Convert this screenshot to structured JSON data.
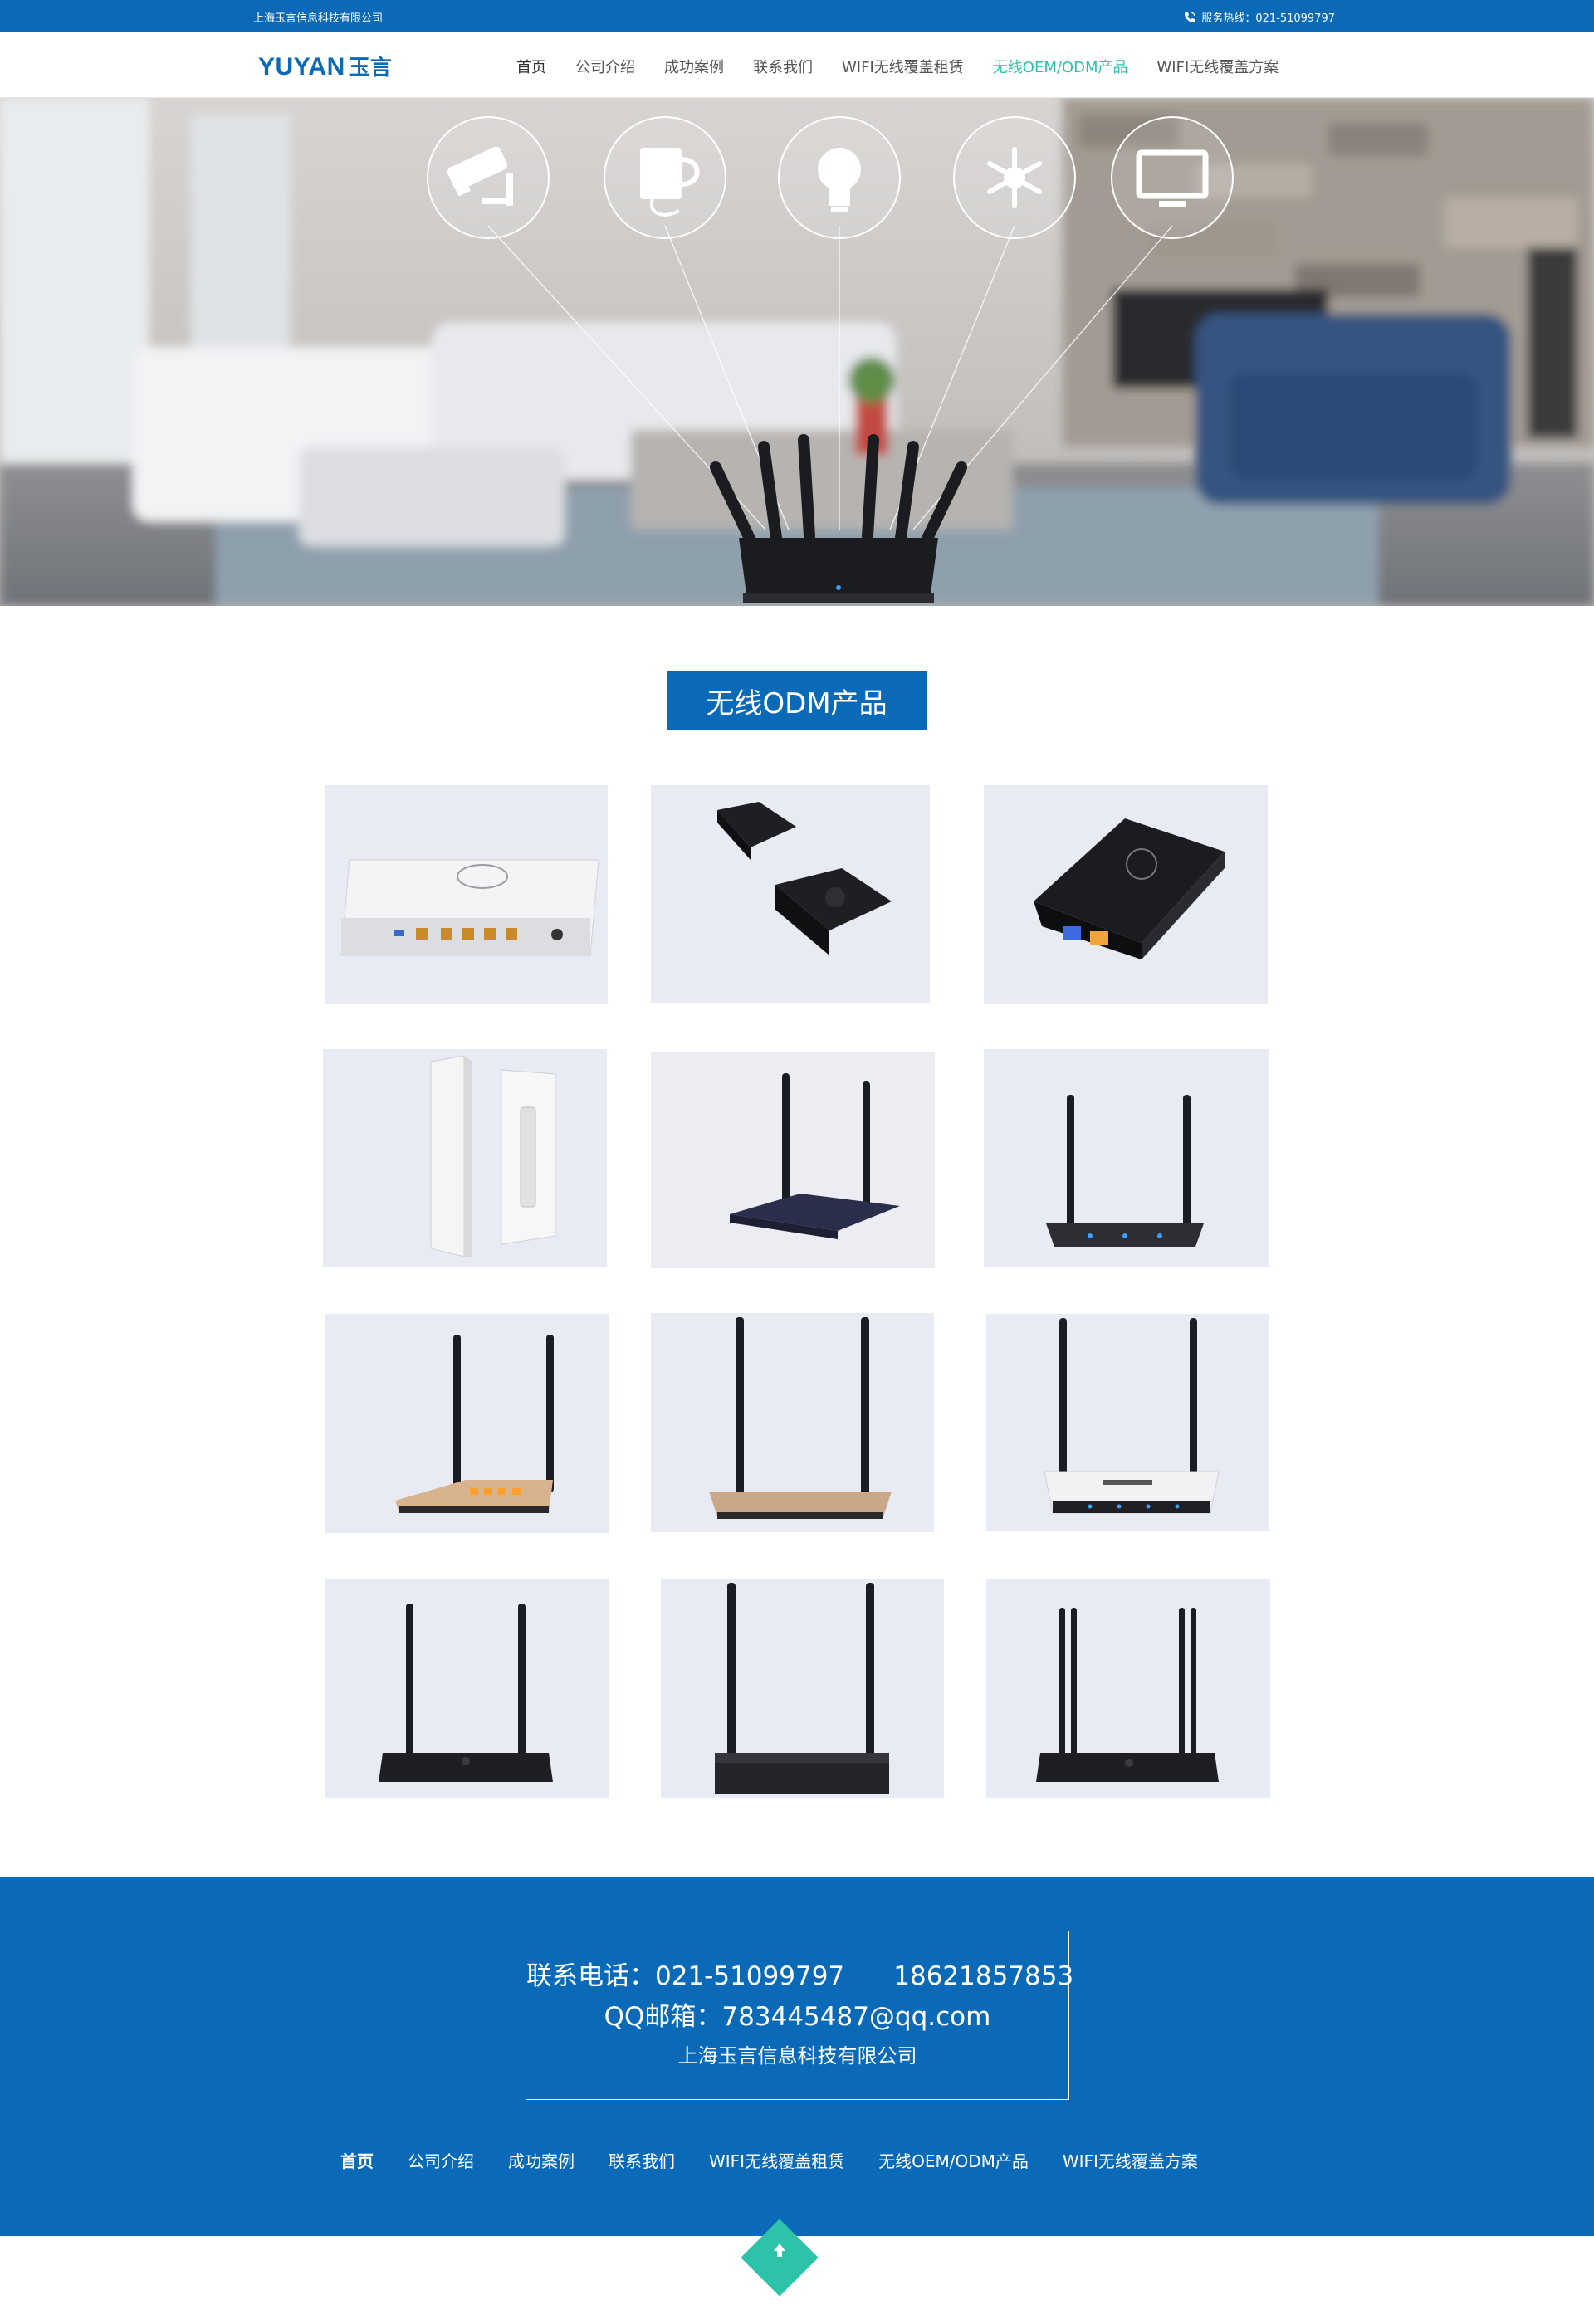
{
  "topbar": {
    "company": "上海玉言信息科技有限公司",
    "hotline": "服务热线：021-51099797"
  },
  "header": {
    "logo_en": "YUYAN",
    "logo_cn": "玉言"
  },
  "nav": [
    {
      "label": "首页"
    },
    {
      "label": "公司介绍"
    },
    {
      "label": "成功案例"
    },
    {
      "label": "联系我们"
    },
    {
      "label": "WIFI无线覆盖租赁"
    },
    {
      "label": "无线OEM/ODM产品"
    },
    {
      "label": "WIFI无线覆盖方案"
    }
  ],
  "section": {
    "title": "无线ODM产品"
  },
  "products": [
    {
      "icon": "router-white-box"
    },
    {
      "icon": "black-square-devices"
    },
    {
      "icon": "black-square-device-ports"
    },
    {
      "icon": "outdoor-ap-white"
    },
    {
      "icon": "router-navy-2-antenna"
    },
    {
      "icon": "router-dark-2-antenna"
    },
    {
      "icon": "router-gold-2-antenna"
    },
    {
      "icon": "router-gold-2-antenna-front"
    },
    {
      "icon": "router-white-2-antenna"
    },
    {
      "icon": "router-black-2-antenna"
    },
    {
      "icon": "router-black-2-antenna-b"
    },
    {
      "icon": "router-black-4-antenna"
    }
  ],
  "footer": {
    "phone_line": "联系电话：021-51099797      18621857853",
    "email_line": "QQ邮箱：783445487@qq.com",
    "company": "上海玉言信息科技有限公司",
    "nav": [
      {
        "label": "首页"
      },
      {
        "label": "公司介绍"
      },
      {
        "label": "成功案例"
      },
      {
        "label": "联系我们"
      },
      {
        "label": "WIFI无线覆盖租赁"
      },
      {
        "label": "无线OEM/ODM产品"
      },
      {
        "label": "WIFI无线覆盖方案"
      }
    ]
  },
  "colors": {
    "brand_blue": "#0b6ab8",
    "accent_teal": "#2cc3a9",
    "product_bg": "#e6e9f2"
  }
}
